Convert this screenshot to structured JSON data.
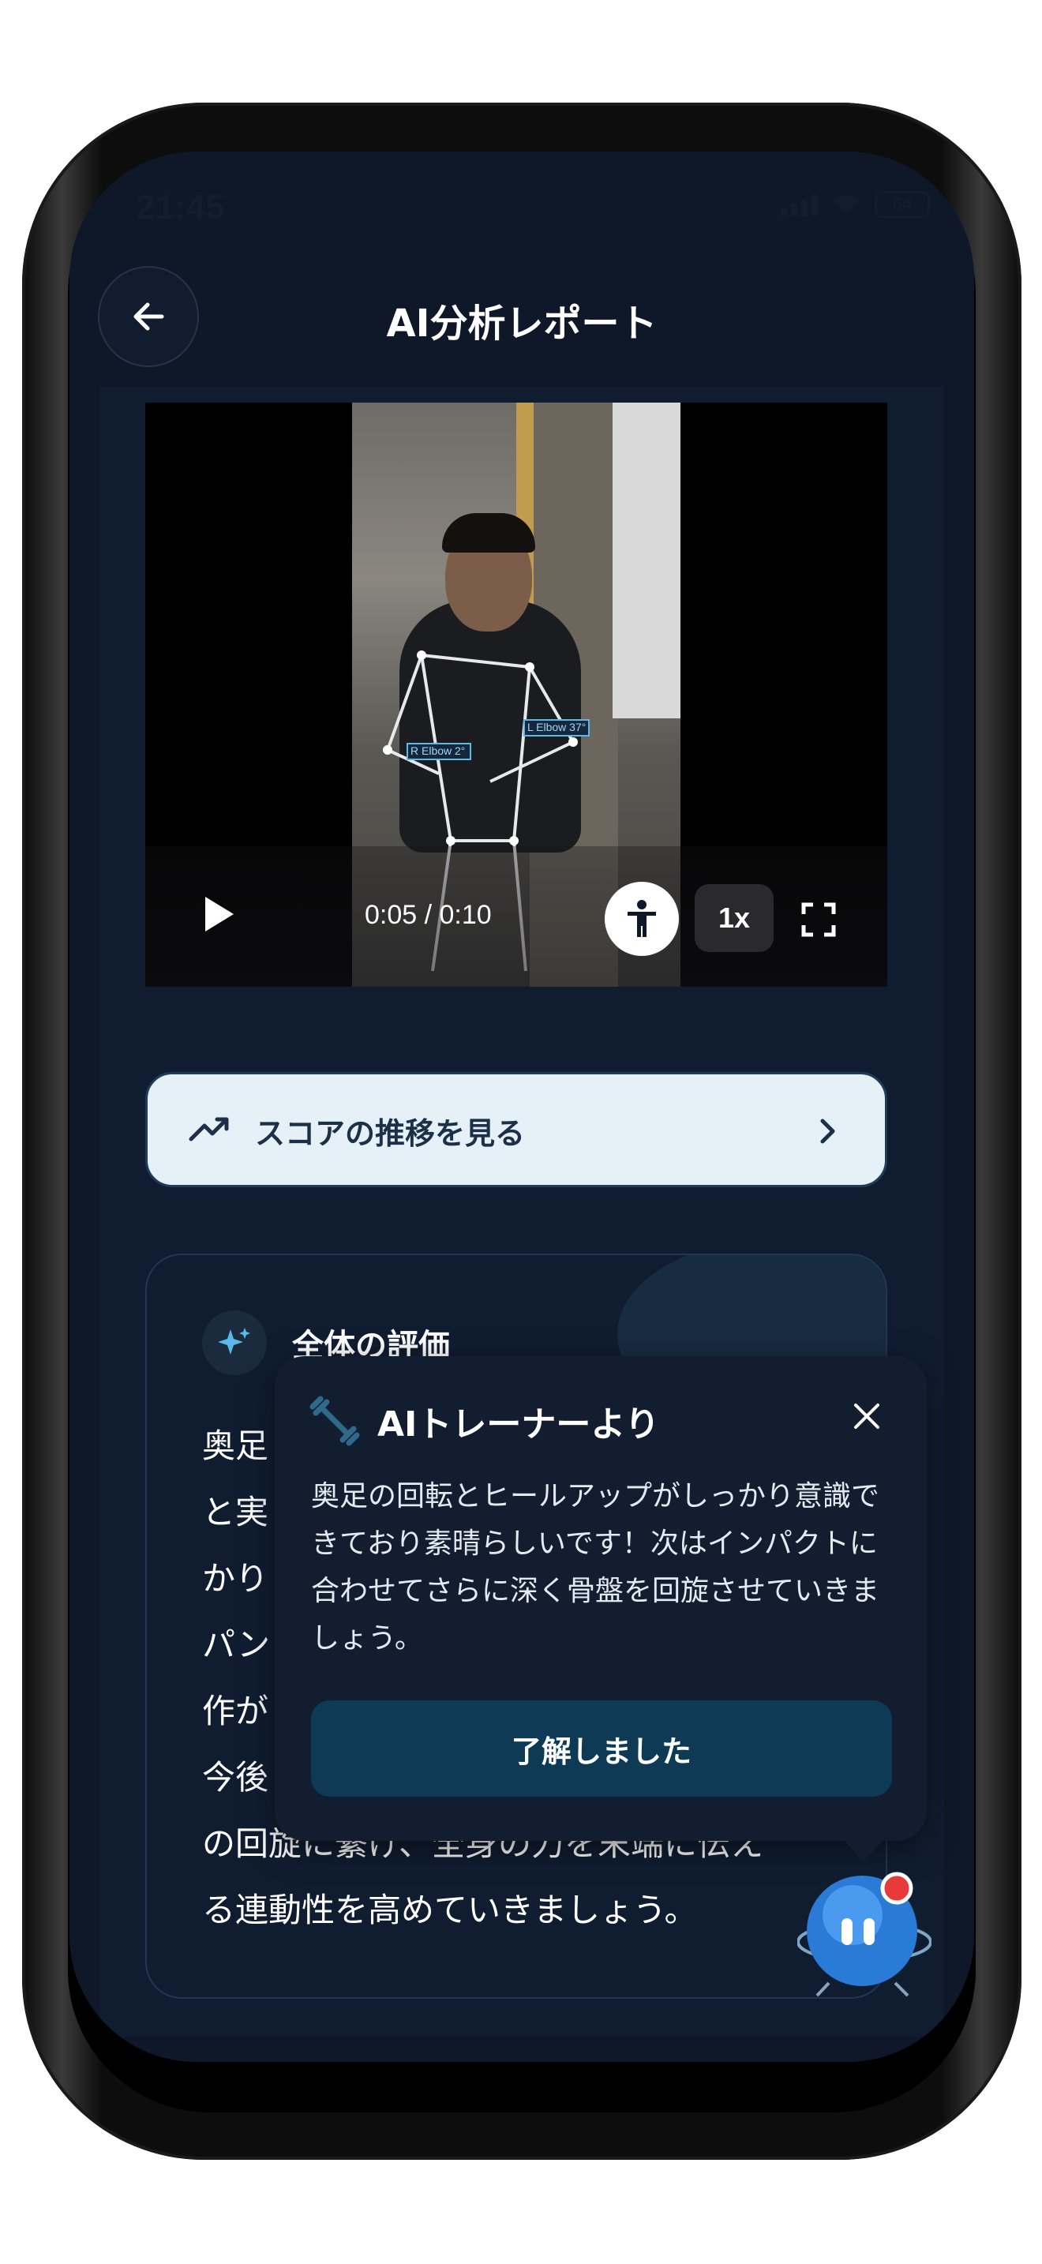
{
  "status_bar": {
    "time": "21:45",
    "battery": "64"
  },
  "header": {
    "title": "AI分析レポート"
  },
  "video": {
    "timecode": "0:05 / 0:10",
    "speed": "1x",
    "overlay_labels": [
      "R Elbow 2°",
      "L Elbow 37°"
    ]
  },
  "score_trend": {
    "label": "スコアの推移を見る"
  },
  "evaluation": {
    "heading": "全体の評価",
    "lines": [
      "奥足",
      "と実",
      "かり",
      "パン",
      "作が",
      "今後",
      "の回旋に繋げ、全身の力を末端に伝え",
      "る連動性を高めていきましょう。"
    ]
  },
  "popup": {
    "title": "AIトレーナーより",
    "body": "奥足の回転とヒールアップがしっかり意識できており素晴らしいです！次はインパクトに合わせてさらに深く骨盤を回旋させていきましょう。",
    "confirm_label": "了解しました"
  },
  "colors": {
    "background": "#0f1829",
    "card": "#101d31",
    "accent": "#5bb8e8",
    "button_light": "#e5f1f7",
    "button_dark": "#0e3a55"
  }
}
